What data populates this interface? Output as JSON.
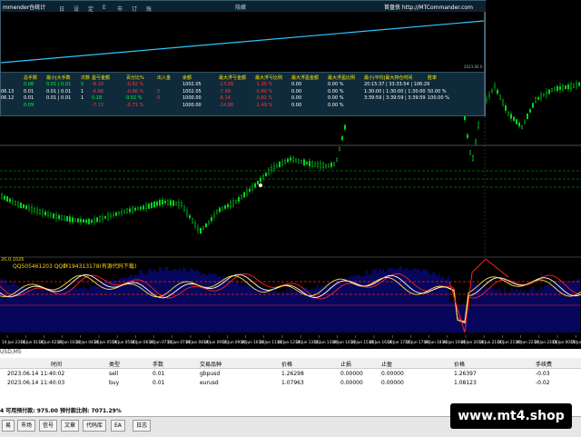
{
  "panel": {
    "title": "mmender仓统计",
    "menu": [
      "日",
      "设",
      "定",
      "E",
      "市",
      "订",
      "账户"
    ],
    "menu_right": "隐藏",
    "brand": "首盘侠 http://MTCommander.com",
    "date_label": "2023.06.0"
  },
  "stats": {
    "headers": [
      "总手数",
      "最小|大手数",
      "次数",
      "盈亏金额",
      "百分比%",
      "出入金",
      "余额",
      "最大浮亏金额",
      "最大浮亏比例",
      "最大浮盈金额",
      "最大浮盈比例",
      "最小|平均|最大持仓时间",
      "胜率"
    ],
    "rows": [
      {
        "label": "",
        "cells": [
          "0.06",
          "0.01 | 0.01",
          "5",
          "-8.10",
          "-0.82 %",
          "",
          "1002.05",
          "-13.09",
          "-1.30 %",
          "0.00",
          "0.00 %",
          "20:15:37 | 33:33:54 | 106:29",
          ""
        ]
      },
      {
        "label": "06.13",
        "cells": [
          "0.01",
          "0.01 | 0.01",
          "1",
          "-6.66",
          "-0.66 %",
          "0",
          "1002.05",
          "-7.99",
          "-0.80 %",
          "0.00",
          "0.00 %",
          "1:30:00 | 1:30:00 | 1:30:00",
          "50.00 %"
        ]
      },
      {
        "label": "06.12",
        "cells": [
          "0.01",
          "0.01 | 0.01",
          "1",
          "0.18",
          "0.02 %",
          "0",
          "1000.00",
          "-8.14",
          "-0.81 %",
          "0.00",
          "0.00 %",
          "3:39:59 | 3:39:59 | 3:39:59",
          "100.00 %"
        ]
      },
      {
        "label": "",
        "cells": [
          "0.09",
          "",
          "",
          "-7.13",
          "-0.71 %",
          "",
          "1000.00",
          "-14.88",
          "-1.49 %",
          "0.00",
          "0.00 %",
          "",
          ""
        ]
      }
    ],
    "date_rows": [
      "06.13",
      "06.12"
    ],
    "equity_label": "2023.06.0"
  },
  "chart_data": {
    "type": "candlestick",
    "indicator_label": "QQ505461203 QQ群194313178(有源代码下载)",
    "indicator_prefix": "20,0.1025",
    "symbol": "USD,M5",
    "time_labels": [
      "14 Jun 23:35",
      "14 Jun 01:35",
      "14 Jun 02:20",
      "14 Jun 03:20",
      "14 Jun 04:20",
      "14 Jun 05:00",
      "14 Jun 05:40",
      "14 Jun 06:20",
      "14 Jun 07:05",
      "14 Jun 07:40",
      "14 Jun 08:20",
      "14 Jun 09:05",
      "14 Jun 09:40",
      "14 Jun 10:20",
      "14 Jun 11:40",
      "14 Jun 12:20",
      "14 Jun 13:05",
      "14 Jun 13:40",
      "14 Jun 14:20",
      "14 Jun 15:40",
      "14 Jun 16:20",
      "14 Jun 17:05",
      "14 Jun 17:40",
      "14 Jun 18:40",
      "14 Jun 19:40",
      "14 Jun 20:20",
      "14 Jun 21:00",
      "14 Jun 21:40",
      "14 Jun 22:20",
      "14 Jun 23:00",
      "15 Jun 00:20",
      "15 Jun 01:00"
    ]
  },
  "trades": {
    "headers": [
      "时间",
      "类型",
      "手数",
      "交易品种",
      "价格",
      "止损",
      "止盈",
      "价格",
      "手续费"
    ],
    "rows": [
      [
        "2023.06.14 11:40:02",
        "sell",
        "0.01",
        "gbpusd",
        "1.26298",
        "0.00000",
        "0.00000",
        "1.26397",
        "-0.03"
      ],
      [
        "2023.06.14 11:40:03",
        "buy",
        "0.01",
        "eurusd",
        "1.07963",
        "0.00000",
        "0.00000",
        "1.08123",
        "-0.02"
      ]
    ],
    "summary": "4  可用预付款: 975.00  预付款比例: 7071.29%"
  },
  "tabs": [
    "易",
    "市场",
    "信号",
    "文章",
    "代码库",
    "EA",
    "日志"
  ],
  "watermark": "www.mt4.shop"
}
